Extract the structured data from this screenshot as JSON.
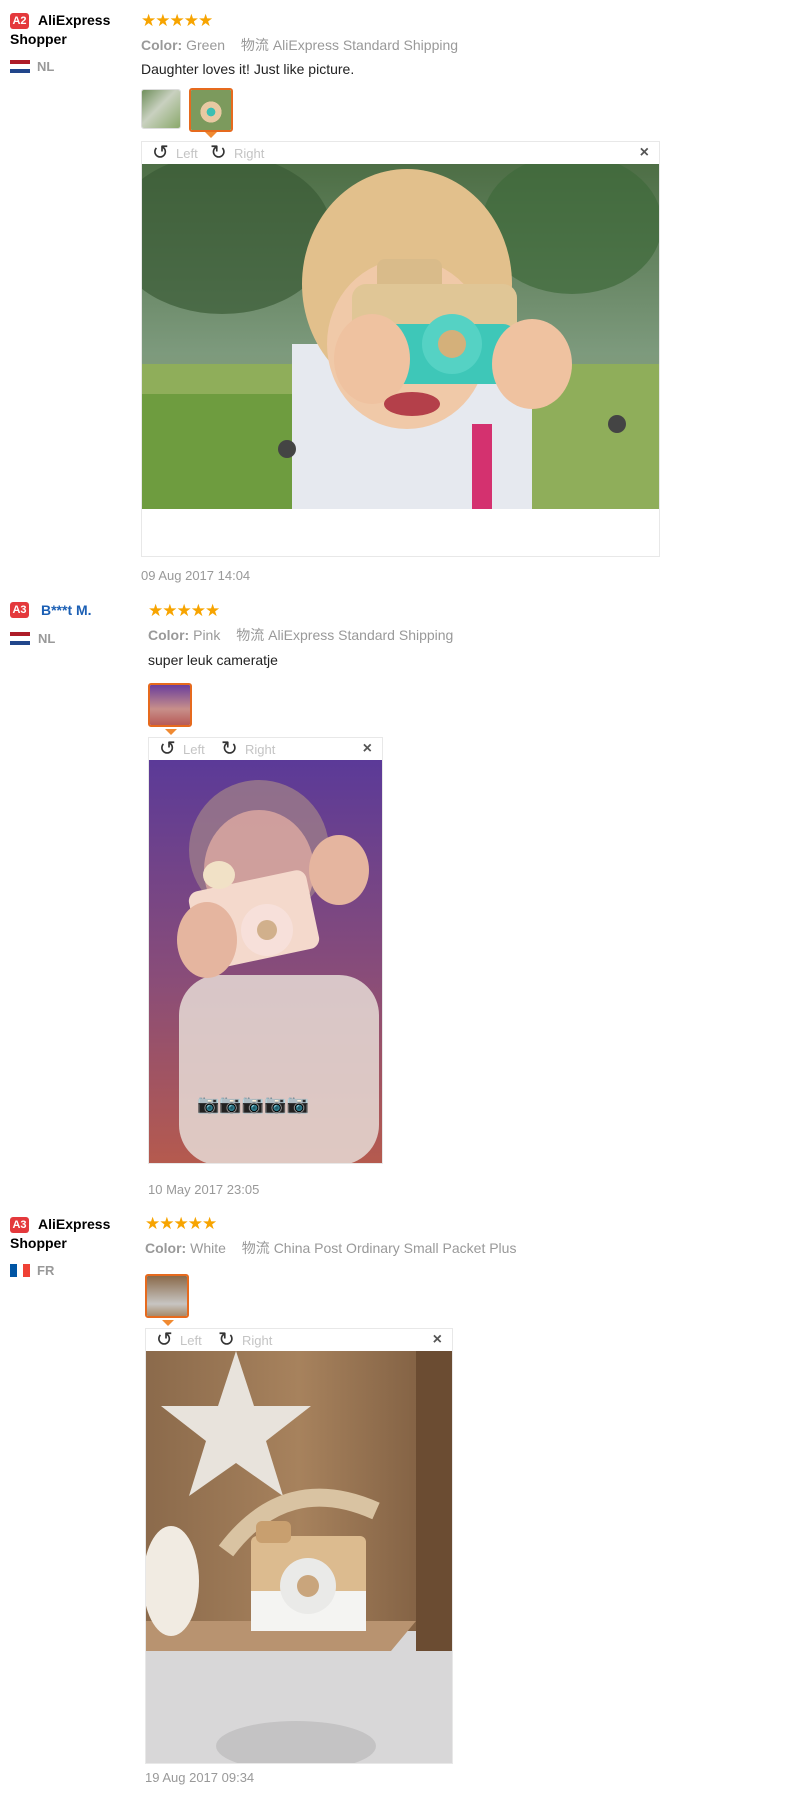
{
  "reviews": [
    {
      "badge": "A2",
      "user": "AliExpress Shopper",
      "country": "NL",
      "stars": "★★★★★",
      "color_label": "Color:",
      "color": "Green",
      "shipping_icon": "物流",
      "shipping": "AliExpress Standard Shipping",
      "text": "Daughter loves it! Just like picture.",
      "viewer": {
        "left": "Left",
        "right": "Right",
        "close": "×"
      },
      "date": "09 Aug 2017 14:04"
    },
    {
      "badge": "A3",
      "user": "B***t M.",
      "country": "NL",
      "stars": "★★★★★",
      "color_label": "Color:",
      "color": "Pink",
      "shipping_icon": "物流",
      "shipping": "AliExpress Standard Shipping",
      "text": "super leuk cameratje",
      "viewer": {
        "left": "Left",
        "right": "Right",
        "close": "×"
      },
      "date": "10 May 2017 23:05"
    },
    {
      "badge": "A3",
      "user": "AliExpress Shopper",
      "country": "FR",
      "stars": "★★★★★",
      "color_label": "Color:",
      "color": "White",
      "shipping_icon": "物流",
      "shipping": "China Post Ordinary Small Packet Plus",
      "viewer": {
        "left": "Left",
        "right": "Right",
        "close": "×"
      },
      "date": "19 Aug 2017 09:34"
    }
  ],
  "colors": {
    "badge": "#e4393c",
    "star": "#f7a400",
    "active_thumb_border": "#e66a1e",
    "username_link": "#1b5fb4"
  }
}
